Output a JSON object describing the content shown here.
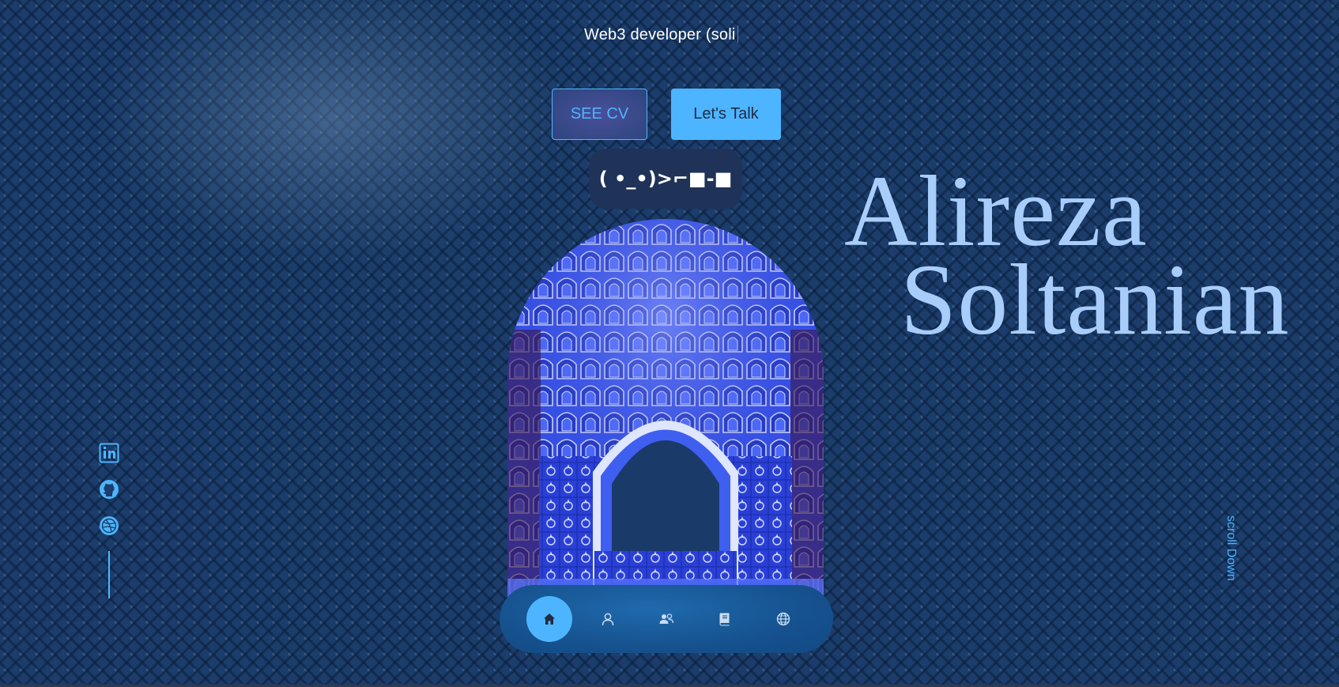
{
  "header": {
    "subtitle": "Web3 developer (soli"
  },
  "actions": {
    "cv_label": "SEE CV",
    "talk_label": "Let's Talk"
  },
  "emote": "( •_•)>⌐■-■",
  "hero": {
    "first_name": "Alireza",
    "last_name": "Soltanian",
    "portrait_icon": "mosque-arch-image"
  },
  "socials": [
    {
      "icon": "linkedin-icon"
    },
    {
      "icon": "github-icon"
    },
    {
      "icon": "dribbble-icon"
    }
  ],
  "scroll_label": "scroll Down",
  "nav": {
    "items": [
      {
        "icon": "home-icon",
        "active": true
      },
      {
        "icon": "user-icon",
        "active": false
      },
      {
        "icon": "users-icon",
        "active": false
      },
      {
        "icon": "book-icon",
        "active": false
      },
      {
        "icon": "globe-icon",
        "active": false
      }
    ]
  },
  "colors": {
    "accent": "#4db5ff",
    "name_text": "#a9cdfb",
    "background": "#1c3d6b",
    "nav_bg": "#16528f"
  }
}
